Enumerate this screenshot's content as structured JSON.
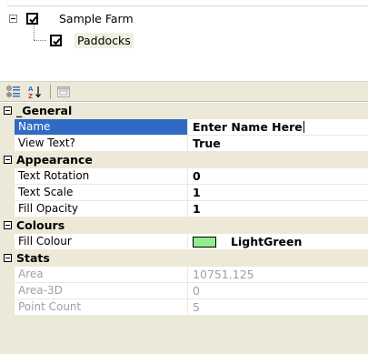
{
  "tree": {
    "root_label": "Sample Farm",
    "child_label": "Paddocks"
  },
  "toolbar": {
    "icons": [
      "categorized-icon",
      "alphabetical-sort-icon",
      "property-pages-icon"
    ]
  },
  "grid": {
    "categories": [
      {
        "label": "_General",
        "properties": [
          {
            "name": "Name",
            "value": "Enter Name Here"
          },
          {
            "name": "View Text?",
            "value": "True"
          }
        ]
      },
      {
        "label": "Appearance",
        "properties": [
          {
            "name": "Text Rotation",
            "value": "0"
          },
          {
            "name": "Text Scale",
            "value": "1"
          },
          {
            "name": "Fill Opacity",
            "value": "1"
          }
        ]
      },
      {
        "label": "Colours",
        "properties": [
          {
            "name": "Fill Colour",
            "value": "LightGreen",
            "swatch": "#90ee90"
          }
        ]
      },
      {
        "label": "Stats",
        "properties": [
          {
            "name": "Area",
            "value": "10751.125"
          },
          {
            "name": "Area-3D",
            "value": "0"
          },
          {
            "name": "Point Count",
            "value": "5"
          }
        ]
      }
    ]
  },
  "colors": {
    "selection": "#316ac5",
    "category_bg": "#ece9d8",
    "readonly_text": "#a0a0a0"
  }
}
